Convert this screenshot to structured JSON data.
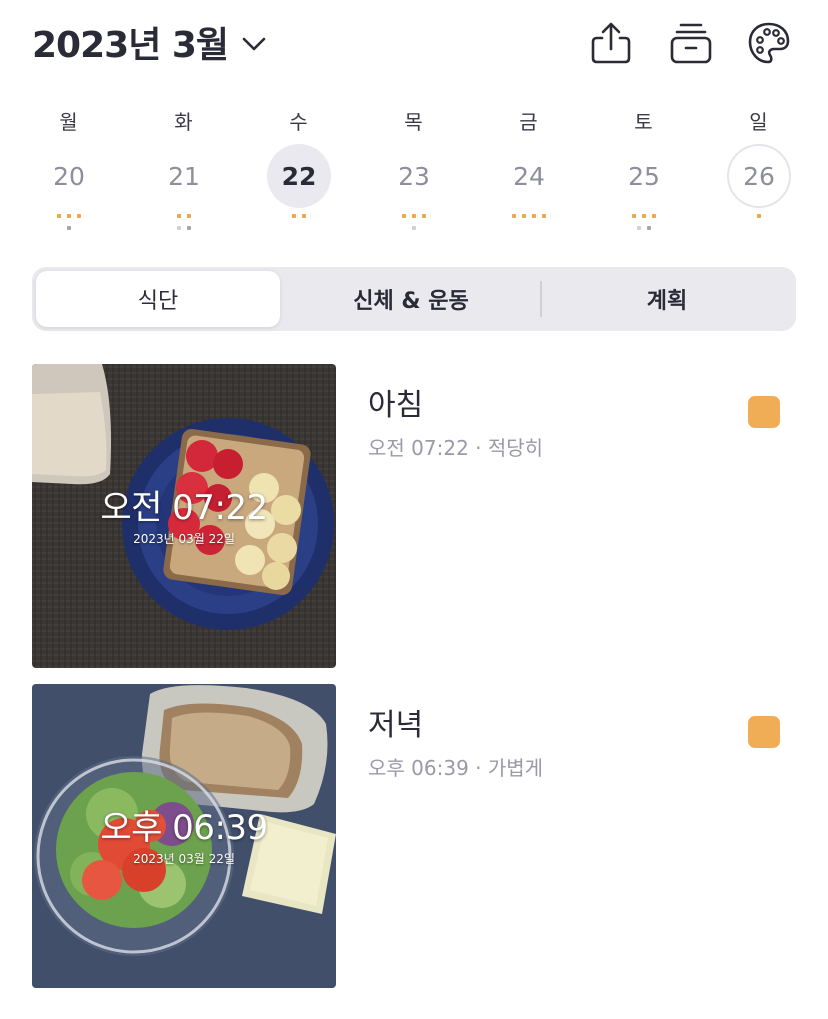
{
  "header": {
    "month_title": "2023년 3월",
    "icons": [
      "share-icon",
      "tray-icon",
      "palette-icon"
    ]
  },
  "week": {
    "days": [
      {
        "dow": "월",
        "date": "20",
        "selected": false,
        "today": false
      },
      {
        "dow": "화",
        "date": "21",
        "selected": false,
        "today": false
      },
      {
        "dow": "수",
        "date": "22",
        "selected": true,
        "today": false
      },
      {
        "dow": "목",
        "date": "23",
        "selected": false,
        "today": false
      },
      {
        "dow": "금",
        "date": "24",
        "selected": false,
        "today": false
      },
      {
        "dow": "토",
        "date": "25",
        "selected": false,
        "today": false
      },
      {
        "dow": "일",
        "date": "26",
        "selected": false,
        "today": true
      }
    ]
  },
  "tabs": [
    {
      "label": "식단",
      "active": true
    },
    {
      "label": "신체 & 운동",
      "active": false
    },
    {
      "label": "계획",
      "active": false
    }
  ],
  "meals": [
    {
      "name": "아침",
      "subtitle": "오전 07:22 · 적당히",
      "photo_time": "오전 07:22",
      "photo_date": "2023년 03월 22일",
      "flag_color": "#f0ad56"
    },
    {
      "name": "저녁",
      "subtitle": "오후 06:39 · 가볍게",
      "photo_time": "오후 06:39",
      "photo_date": "2023년 03월 22일",
      "flag_color": "#f0ad56"
    }
  ],
  "colors": {
    "accent_orange": "#f0a646",
    "text_primary": "#2b2b38",
    "text_secondary": "#9a9aa6",
    "segment_bg": "#e9e9ee"
  }
}
